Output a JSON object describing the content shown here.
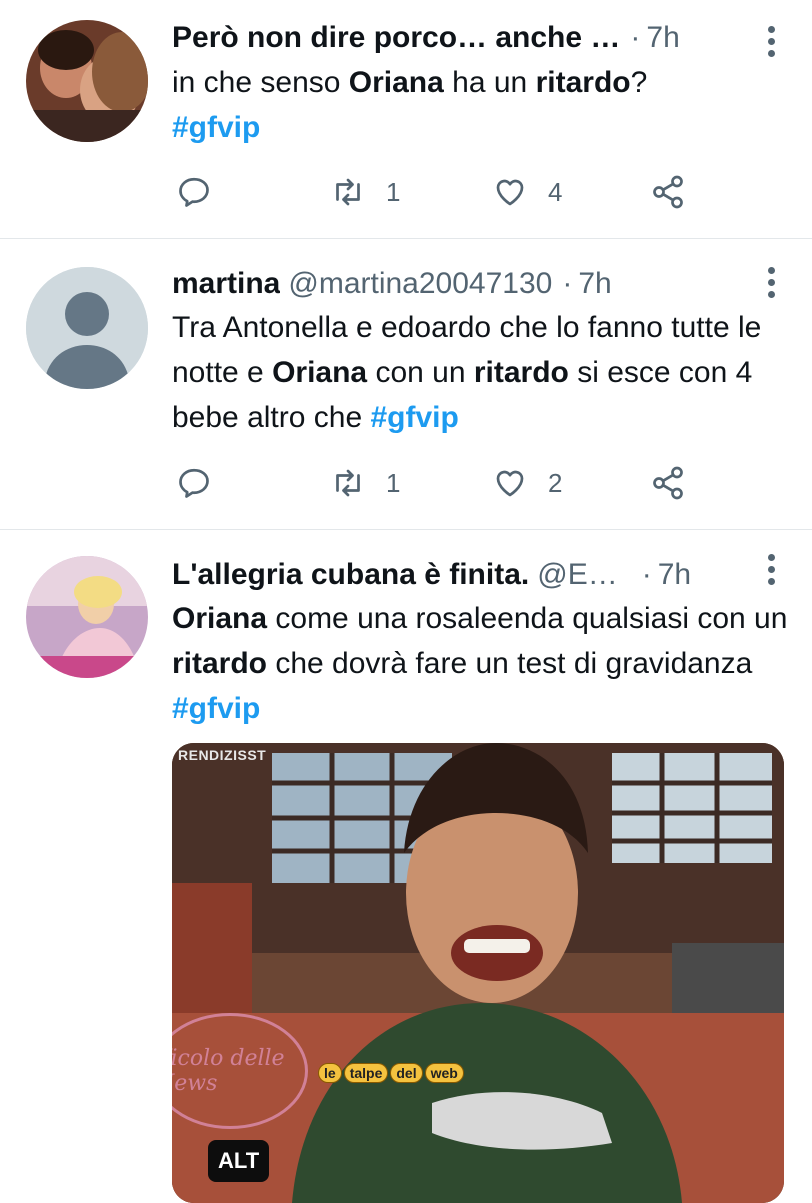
{
  "tweets": [
    {
      "name": "Però non dire porco… anche …",
      "handle": "",
      "time": "7h",
      "text": [
        {
          "t": "in che senso ",
          "b": false
        },
        {
          "t": "Oriana",
          "b": true
        },
        {
          "t": " ha un ",
          "b": false
        },
        {
          "t": "ritardo",
          "b": true
        },
        {
          "t": "?",
          "b": false
        }
      ],
      "hashtag": "#gfvip",
      "replies": "",
      "retweets": "1",
      "likes": "4"
    },
    {
      "name": "martina",
      "handle": "@martina20047130",
      "time": "7h",
      "text": [
        {
          "t": "Tra Antonella e edoardo che lo fanno tutte le notte e ",
          "b": false
        },
        {
          "t": "Oriana",
          "b": true
        },
        {
          "t": " con un ",
          "b": false
        },
        {
          "t": "ritardo",
          "b": true
        },
        {
          "t": " si esce con 4 bebe altro che ",
          "b": false
        }
      ],
      "hashtag": "#gfvip",
      "replies": "",
      "retweets": "1",
      "likes": "2"
    },
    {
      "name": "L'allegria cubana è finita.",
      "handle": "@E…",
      "time": "7h",
      "text": [
        {
          "t": "Oriana",
          "b": true
        },
        {
          "t": " come una rosaleenda qualsiasi con un ",
          "b": false
        },
        {
          "t": "ritardo",
          "b": true
        },
        {
          "t": " che dovrà fare un test di gravidanza ",
          "b": false
        }
      ],
      "hashtag": "#gfvip"
    }
  ],
  "media": {
    "source_label": "RENDIZISST",
    "alt_badge": "ALT",
    "watermark_left": "Vicolo delle News",
    "watermark_right": [
      "le",
      "talpe",
      "del",
      "web"
    ]
  },
  "colors": {
    "link": "#1d9bf0",
    "muted": "#536471",
    "text": "#0f1419"
  },
  "icons": [
    "reply-icon",
    "retweet-icon",
    "like-icon",
    "share-icon",
    "more-icon"
  ]
}
